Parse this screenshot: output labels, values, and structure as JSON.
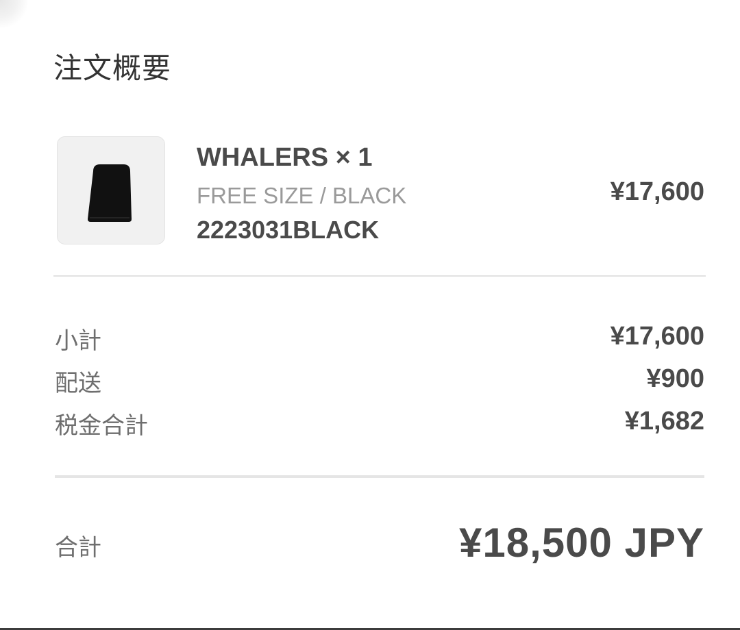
{
  "page": {
    "title": "注文概要"
  },
  "order_item": {
    "name": "WHALERS × 1",
    "variant": "FREE SIZE / BLACK",
    "sku": "2223031BLACK",
    "price": "¥17,600",
    "thumbnail_icon": "black-beanie-product-image"
  },
  "summary": {
    "subtotal": {
      "label": "小計",
      "value": "¥17,600"
    },
    "shipping": {
      "label": "配送",
      "value": "¥900"
    },
    "tax": {
      "label": "税金合計",
      "value": "¥1,682"
    }
  },
  "total": {
    "label": "合計",
    "value": "¥18,500 JPY"
  },
  "colors": {
    "text": "#4a4a4a",
    "muted": "#9a9a9a",
    "divider": "#e2e2e2"
  }
}
